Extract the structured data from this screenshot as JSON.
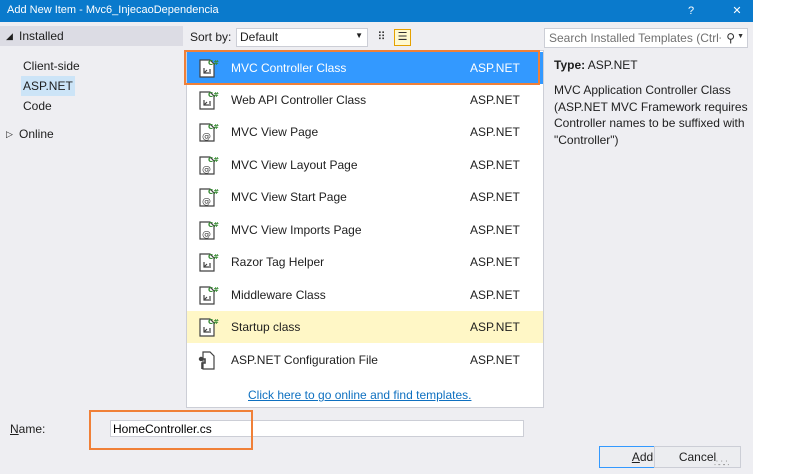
{
  "window": {
    "title": "Add New Item - Mvc6_InjecaoDependencia",
    "help_glyph": "?",
    "close_glyph": "✕"
  },
  "tree": {
    "installed": {
      "label": "Installed",
      "arrow": "◢"
    },
    "children": [
      {
        "label": "Client-side"
      },
      {
        "label": "ASP.NET"
      },
      {
        "label": "Code"
      }
    ],
    "online": {
      "label": "Online",
      "arrow": "▷"
    }
  },
  "toolbar": {
    "sort_by_label": "Sort by:",
    "sort_value": "Default",
    "sort_arrow": "▼",
    "view_small_icons_glyph": "⠿",
    "view_list_glyph": "☰"
  },
  "search": {
    "placeholder": "Search Installed Templates (Ctrl+E)",
    "icon": "⚲",
    "arrow": "▼"
  },
  "templates": [
    {
      "name": "MVC Controller Class",
      "lang": "ASP.NET",
      "icon": "cs-arrows"
    },
    {
      "name": "Web API Controller Class",
      "lang": "ASP.NET",
      "icon": "cs-arrows"
    },
    {
      "name": "MVC View Page",
      "lang": "ASP.NET",
      "icon": "cs-at"
    },
    {
      "name": "MVC View Layout Page",
      "lang": "ASP.NET",
      "icon": "cs-at"
    },
    {
      "name": "MVC View Start Page",
      "lang": "ASP.NET",
      "icon": "cs-at"
    },
    {
      "name": "MVC View Imports Page",
      "lang": "ASP.NET",
      "icon": "cs-at"
    },
    {
      "name": "Razor Tag Helper",
      "lang": "ASP.NET",
      "icon": "cs-arrows"
    },
    {
      "name": "Middleware Class",
      "lang": "ASP.NET",
      "icon": "cs-arrows"
    },
    {
      "name": "Startup class",
      "lang": "ASP.NET",
      "icon": "cs-arrows"
    },
    {
      "name": "ASP.NET Configuration File",
      "lang": "ASP.NET",
      "icon": "config"
    }
  ],
  "online_link": "Click here to go online and find templates.",
  "details": {
    "type_label": "Type:",
    "type_value": "ASP.NET",
    "description": "MVC Application Controller Class (ASP.NET MVC Framework requires Controller names to be suffixed with \"Controller\")"
  },
  "name_field": {
    "label_underlined": "N",
    "label_rest": "ame:",
    "value": "HomeController.cs"
  },
  "buttons": {
    "add_underlined": "A",
    "add_rest": "dd",
    "cancel": "Cancel"
  },
  "colors": {
    "titlebar": "#0a7acc",
    "selection": "#3399ff",
    "hover_row": "#fff7c6",
    "highlight_box": "#f08038",
    "link": "#0e70c0",
    "cs_badge": "#388a34"
  }
}
